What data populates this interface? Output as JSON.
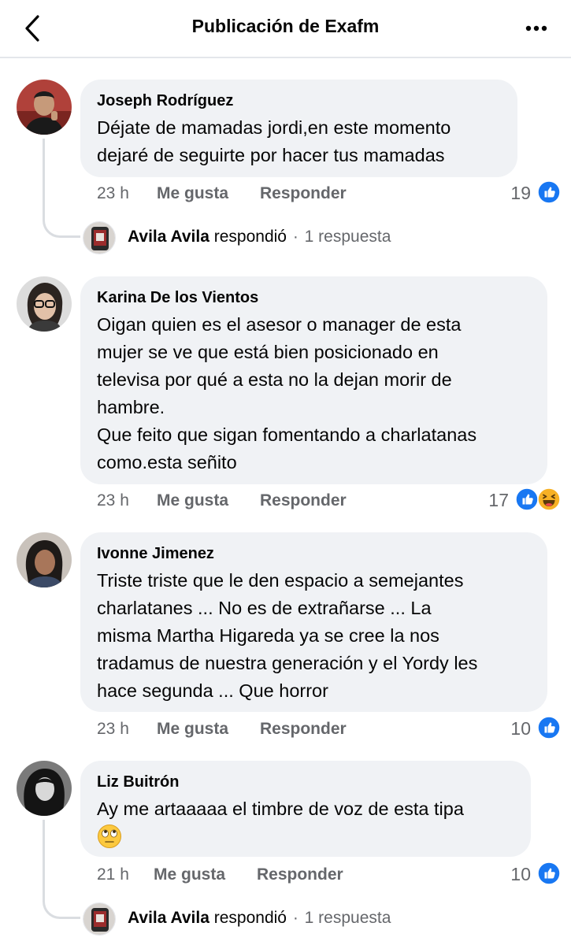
{
  "header": {
    "title": "Publicación de Exafm"
  },
  "comments": [
    {
      "author": "Joseph Rodríguez",
      "lines": [
        "Déjate de mamadas jordi,en este momento",
        "dejaré de seguirte por hacer tus mamadas"
      ],
      "time": "23 h",
      "like_label": "Me gusta",
      "reply_label": "Responder",
      "reaction_count": "19",
      "reactions": [
        "like-icon"
      ],
      "reply_summary": {
        "name": "Avila Avila",
        "verb": "respondió",
        "dot": "·",
        "count": "1 respuesta"
      }
    },
    {
      "author": "Karina De los Vientos",
      "lines": [
        "Oigan quien es el asesor o manager de esta",
        "mujer se ve que está bien posicionado en",
        "televisa por qué a esta no la dejan morir de",
        "hambre.",
        "Que feito que sigan fomentando a charlatanas",
        "como.esta señito"
      ],
      "time": "23 h",
      "like_label": "Me gusta",
      "reply_label": "Responder",
      "reaction_count": "17",
      "reactions": [
        "like-icon",
        "haha-icon"
      ]
    },
    {
      "author": "Ivonne Jimenez",
      "lines": [
        "Triste triste que le den espacio a semejantes",
        "charlatanes ... No es de extrañarse ... La",
        "misma Martha Higareda ya se cree la nos",
        "tradamus de nuestra generación y el Yordy les",
        "hace segunda ... Que horror"
      ],
      "time": "23 h",
      "like_label": "Me gusta",
      "reply_label": "Responder",
      "reaction_count": "10",
      "reactions": [
        "like-icon"
      ]
    },
    {
      "author": "Liz Buitrón",
      "lines": [
        "Ay me artaaaaa el timbre de voz de esta tipa"
      ],
      "emoji": "face-with-rolling-eyes-emoji",
      "time": "21 h",
      "like_label": "Me gusta",
      "reply_label": "Responder",
      "reaction_count": "10",
      "reactions": [
        "like-icon"
      ],
      "reply_summary": {
        "name": "Avila Avila",
        "verb": "respondió",
        "dot": "·",
        "count": "1 respuesta"
      }
    }
  ],
  "colors": {
    "bubble": "#f0f2f5",
    "secondary_text": "#65676b",
    "like_blue": "#1877f2",
    "haha_yellow": "#f7b125"
  }
}
